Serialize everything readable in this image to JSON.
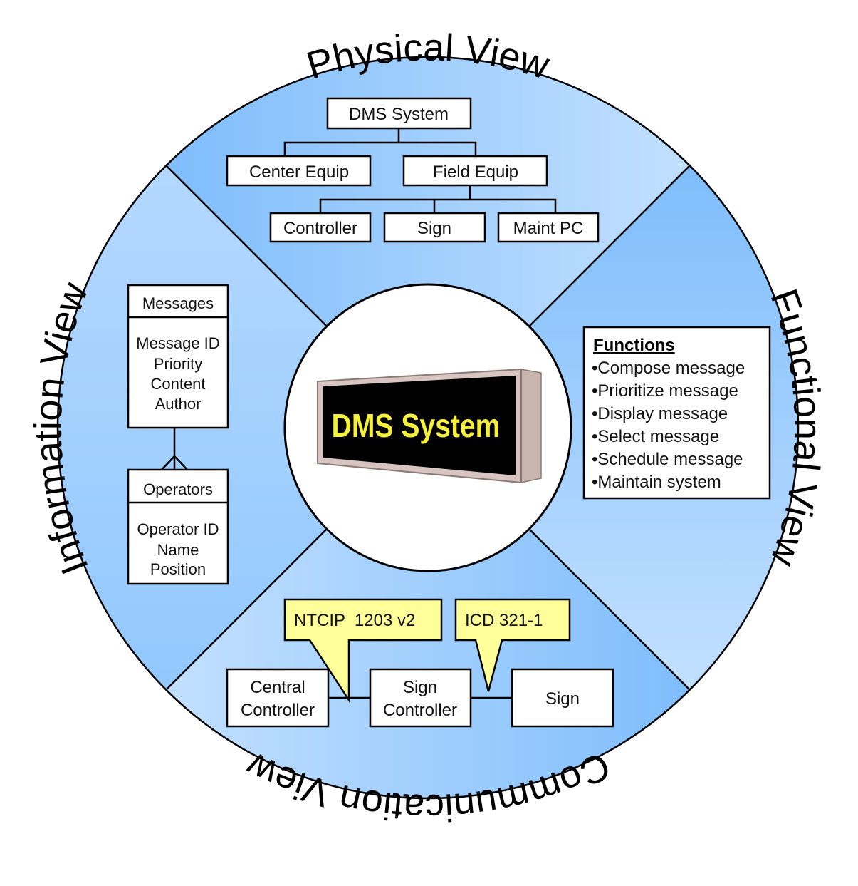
{
  "views": {
    "physical": "Physical View",
    "functional": "Functional View",
    "communication": "Communication View",
    "information": "Information View"
  },
  "center_sign": {
    "text": "DMS System"
  },
  "physical": {
    "root": "DMS System",
    "level1": [
      "Center Equip",
      "Field Equip"
    ],
    "level2": [
      "Controller",
      "Sign",
      "Maint PC"
    ]
  },
  "functional": {
    "title": "Functions",
    "items": [
      "•Compose message",
      "•Prioritize message",
      "•Display message",
      "•Select message",
      "•Schedule message",
      "•Maintain system"
    ]
  },
  "information": {
    "messages": {
      "title": "Messages",
      "fields": [
        "Message ID",
        "Priority",
        "Content",
        "Author"
      ]
    },
    "operators": {
      "title": "Operators",
      "fields": [
        "Operator ID",
        "Name",
        "Position"
      ]
    }
  },
  "communication": {
    "nodes": [
      [
        "Central",
        "Controller"
      ],
      [
        "Sign",
        "Controller"
      ],
      [
        "Sign"
      ]
    ],
    "callouts": [
      "NTCIP  1203 v2",
      "ICD 321-1"
    ]
  },
  "colors": {
    "dark_blue": "#7fbdfb",
    "light_blue": "#bcdcff",
    "callout": "#ffff99",
    "sign_text": "#f5f03a"
  }
}
